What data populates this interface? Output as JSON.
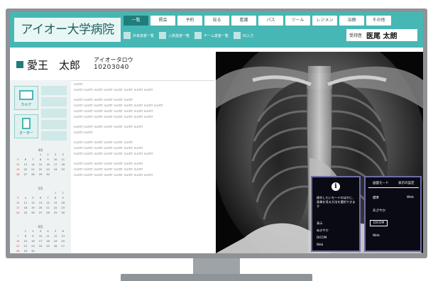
{
  "header": {
    "hospital_name": "アイオー大学病院",
    "tabs": [
      "一覧",
      "照会",
      "予約",
      "見る",
      "看護",
      "パス",
      "ツール",
      "レジメン",
      "治療",
      "その他"
    ],
    "active_tab_index": 0,
    "subitems": [
      "外来患者一覧",
      "入院患者一覧",
      "チーム患者一覧",
      "ID入力"
    ],
    "physician_label": "受持医",
    "physician_name": "医尾 太朗"
  },
  "patient": {
    "name": "愛王　太郎",
    "kana": "アイオータロウ",
    "id": "10203040"
  },
  "left_nav": {
    "karte_label": "カルテ",
    "order_label": "オーダー"
  },
  "calendars": [
    {
      "title": "4月",
      "weeks": [
        [
          "",
          "",
          "",
          "1",
          "2",
          "3",
          "4"
        ],
        [
          "5",
          "6",
          "7",
          "8",
          "9",
          "10",
          "11"
        ],
        [
          "12",
          "13",
          "14",
          "15",
          "16",
          "17",
          "18"
        ],
        [
          "19",
          "20",
          "21",
          "22",
          "23",
          "24",
          "25"
        ],
        [
          "26",
          "27",
          "28",
          "29",
          "30",
          "",
          ""
        ]
      ]
    },
    {
      "title": "5月",
      "weeks": [
        [
          "",
          "",
          "",
          "",
          "",
          "1",
          "2"
        ],
        [
          "3",
          "4",
          "5",
          "6",
          "7",
          "8",
          "9"
        ],
        [
          "10",
          "11",
          "12",
          "13",
          "14",
          "15",
          "16"
        ],
        [
          "17",
          "18",
          "19",
          "20",
          "21",
          "22",
          "23"
        ],
        [
          "24",
          "25",
          "26",
          "27",
          "28",
          "29",
          "30"
        ]
      ]
    },
    {
      "title": "6月",
      "weeks": [
        [
          "",
          "1",
          "2",
          "3",
          "4",
          "5",
          "6"
        ],
        [
          "7",
          "8",
          "9",
          "10",
          "11",
          "12",
          "13"
        ],
        [
          "14",
          "15",
          "16",
          "17",
          "18",
          "19",
          "20"
        ],
        [
          "21",
          "22",
          "23",
          "24",
          "25",
          "26",
          "27"
        ],
        [
          "28",
          "29",
          "30",
          "",
          "",
          "",
          ""
        ]
      ]
    }
  ],
  "notes": {
    "lines": [
      "Isoftf",
      "Isoftf Isoftf Isoftf Isoftf Isoftf Isoftf Isoftf Isoftf",
      "",
      "Isoftf Isoftf Isoftf Isoftf Isoftf Isoftf",
      "Isoftf Isoftf Isoftf Isoftf Isoftf Isoftf Isoftf Isoftf Isoftf",
      "Isoftf Isoftf Isoftf Isoftf Isoftf Isoftf Isoftf Isoftf",
      "Isoftf Isoftf Isoftf Isoftf Isoftf Isoftf Isoftf Isoftf",
      "",
      "Isoftf Isoftf Isoftf Isoftf Isoftf Isoftf Isoftf",
      "Isoftf Isoftf",
      "",
      "Isoftf Isoftf Isoftf Isoftf Isoftf Isoftf",
      "Isoftf Isoftf Isoftf Isoftf Isoftf Isoftf Isoftf",
      "Isoftf Isoftf Isoftf Isoftf Isoftf Isoftf Isoftf Isoftf",
      "",
      "Isoftf Isoftf Isoftf Isoftf Isoftf Isoftf Isoftf",
      "Isoftf Isoftf Isoftf Isoftf Isoftf Isoftf Isoftf",
      "Isoftf Isoftf Isoftf Isoftf Isoftf Isoftf Isoftf Isoftf"
    ]
  },
  "viewer_menu": {
    "message": "操作したいモードのほかに、画像を見る方法を選択できます",
    "items": [
      "表示",
      "ぬきやか",
      "DICOM",
      "Web"
    ]
  },
  "mode_panel": {
    "heading_left": "画面モード",
    "heading_right": "表示の設定",
    "options": [
      "標準",
      "Web",
      "あざやか",
      "DICOM",
      "Web"
    ],
    "selected": "DICOM"
  },
  "colors": {
    "brand": "#46b7b4",
    "accent": "#1f7d7a"
  }
}
